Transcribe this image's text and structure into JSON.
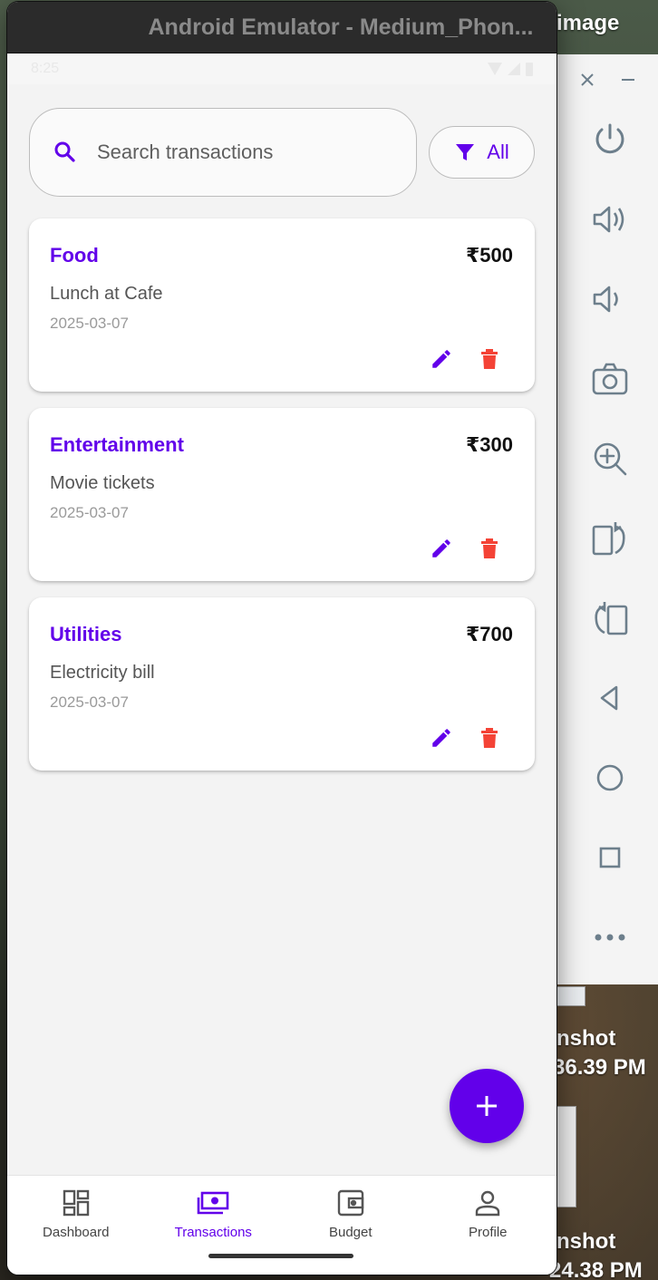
{
  "desktop": {
    "label_image": "image",
    "label_shot_1": "nshot",
    "label_time_1": "36.39 PM",
    "label_shot_2": "nshot",
    "label_time_2": "24.38 PM"
  },
  "window": {
    "title": "Android Emulator - Medium_Phon..."
  },
  "status_bar": {
    "time": "8:25"
  },
  "search": {
    "placeholder": "Search transactions",
    "value": ""
  },
  "filter": {
    "label": "All"
  },
  "transactions": [
    {
      "category": "Food",
      "amount": "₹500",
      "description": "Lunch at Cafe",
      "date": "2025-03-07"
    },
    {
      "category": "Entertainment",
      "amount": "₹300",
      "description": "Movie tickets",
      "date": "2025-03-07"
    },
    {
      "category": "Utilities",
      "amount": "₹700",
      "description": "Electricity bill",
      "date": "2025-03-07"
    }
  ],
  "bottom_nav": {
    "items": [
      {
        "label": "Dashboard",
        "icon": "dashboard-icon"
      },
      {
        "label": "Transactions",
        "icon": "money-icon"
      },
      {
        "label": "Budget",
        "icon": "wallet-icon"
      },
      {
        "label": "Profile",
        "icon": "person-icon"
      }
    ],
    "active": "Transactions"
  },
  "emulator_toolbar": {
    "buttons": [
      "close-icon",
      "minimize-icon",
      "power-icon",
      "volume-up-icon",
      "volume-down-icon",
      "camera-icon",
      "zoom-in-icon",
      "rotate-left-icon",
      "rotate-right-icon",
      "back-icon",
      "home-icon",
      "overview-icon",
      "more-icon"
    ]
  },
  "colors": {
    "accent": "#6200ea",
    "delete": "#f44336",
    "card_bg": "#ffffff",
    "app_bg": "#f3f3f3"
  }
}
